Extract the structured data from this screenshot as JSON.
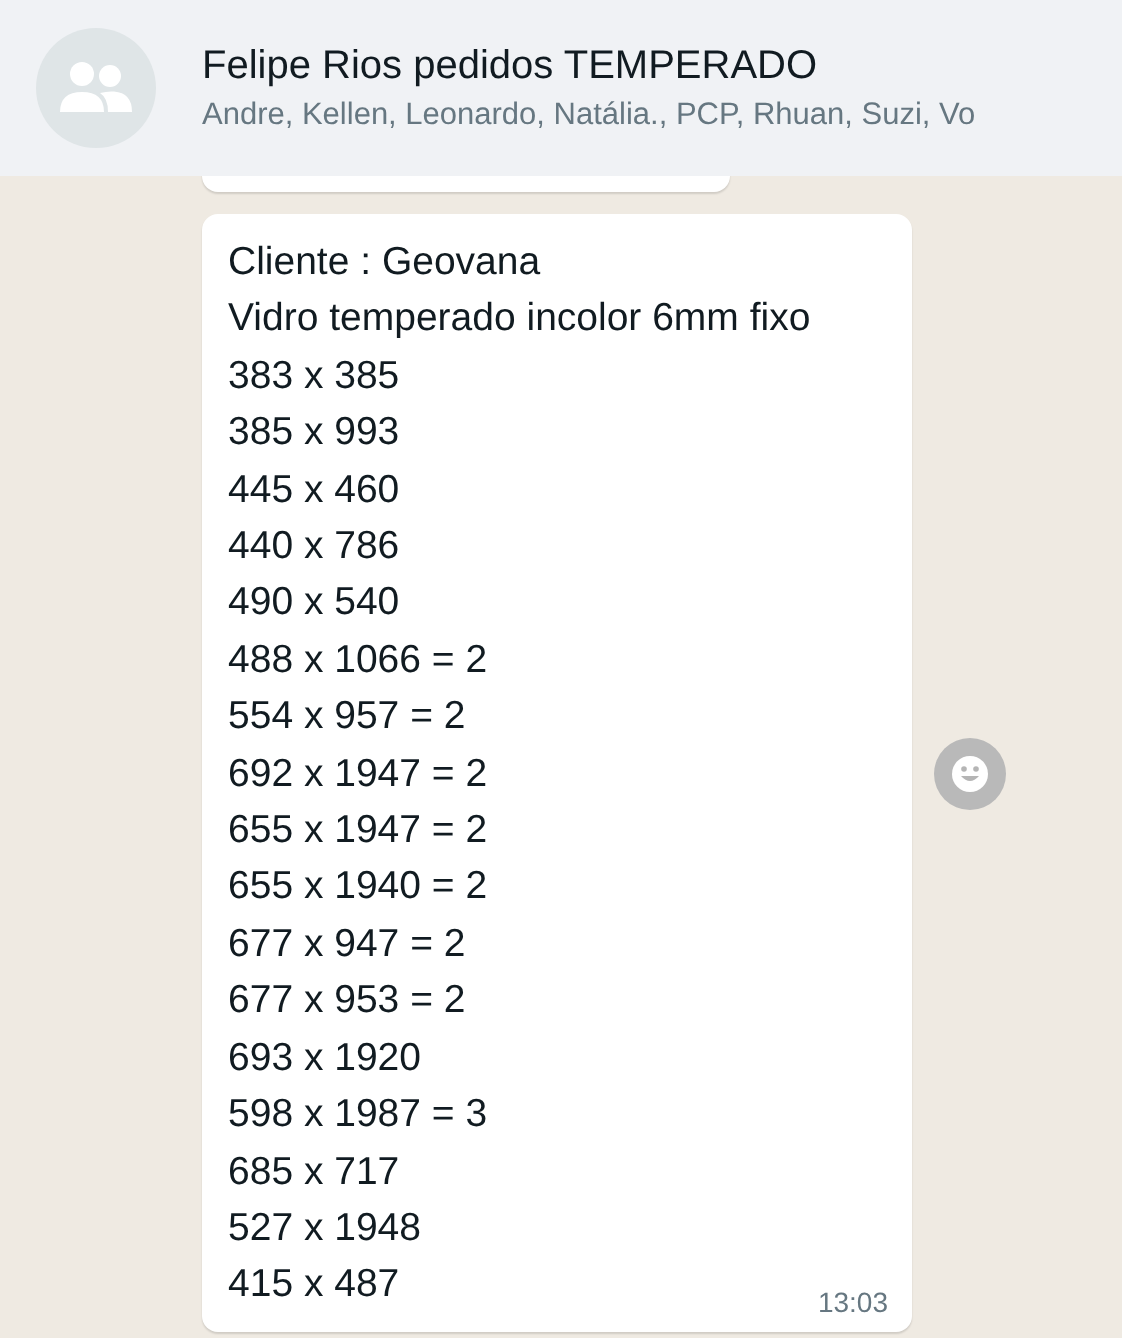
{
  "header": {
    "title": "Felipe Rios pedidos TEMPERADO",
    "participants": "Andre, Kellen, Leonardo, Natália., PCP, Rhuan, Suzi, Vo"
  },
  "message": {
    "lines": [
      "Cliente : Geovana",
      "Vidro temperado incolor 6mm fixo",
      "383 x 385",
      "385 x 993",
      "445 x 460",
      "440 x 786",
      "490 x 540",
      "488 x 1066 = 2",
      "554 x 957 = 2",
      "692 x 1947 = 2",
      "655 x 1947 = 2",
      "655 x 1940 = 2",
      "677 x 947 = 2",
      "677 x 953 = 2",
      "693 x 1920",
      "598 x 1987 = 3",
      "685 x 717",
      "527 x 1948",
      "415 x 487"
    ],
    "time": "13:03"
  }
}
